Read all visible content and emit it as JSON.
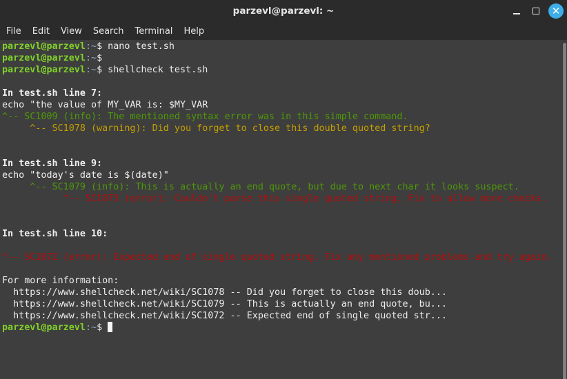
{
  "window": {
    "title": "parzevl@parzevl: ~",
    "controls": {
      "minimize_icon": "minimize-icon",
      "maximize_icon": "maximize-icon",
      "close_icon": "close-icon",
      "close_glyph": "✕"
    },
    "accent_color": "#3daee9"
  },
  "menubar": {
    "items": [
      "File",
      "Edit",
      "View",
      "Search",
      "Terminal",
      "Help"
    ]
  },
  "terminal": {
    "prompt_user": "parzevl@parzevl",
    "prompt_sep": ":",
    "prompt_path": "~",
    "prompt_symbol": "$",
    "colors": {
      "prompt": "#80d12a",
      "info": "#4e9a06",
      "warning": "#c4a000",
      "error": "#b80d0d",
      "text": "#ededed"
    },
    "lines": [
      {
        "type": "prompt",
        "command": " nano test.sh"
      },
      {
        "type": "prompt",
        "command": ""
      },
      {
        "type": "prompt",
        "command": " shellcheck test.sh"
      },
      {
        "type": "blank",
        "text": ""
      },
      {
        "type": "bold",
        "text": "In test.sh line 7:"
      },
      {
        "type": "plain",
        "text": "echo \"the value of MY_VAR is: $MY_VAR"
      },
      {
        "type": "info",
        "text": "^-- SC1009 (info): The mentioned syntax error was in this simple command."
      },
      {
        "type": "warn",
        "text": "     ^-- SC1078 (warning): Did you forget to close this double quoted string?"
      },
      {
        "type": "blank",
        "text": ""
      },
      {
        "type": "blank",
        "text": ""
      },
      {
        "type": "bold",
        "text": "In test.sh line 9:"
      },
      {
        "type": "plain",
        "text": "echo \"today's date is $(date)\""
      },
      {
        "type": "info",
        "text": "     ^-- SC1079 (info): This is actually an end quote, but due to next char it looks suspect."
      },
      {
        "type": "err",
        "text": "           ^-- SC1073 (error): Couldn't parse this single quoted string. Fix to allow more checks."
      },
      {
        "type": "blank",
        "text": ""
      },
      {
        "type": "blank",
        "text": ""
      },
      {
        "type": "bold",
        "text": "In test.sh line 10:"
      },
      {
        "type": "blank",
        "text": ""
      },
      {
        "type": "err",
        "text": "^-- SC1072 (error): Expected end of single quoted string. Fix any mentioned problems and try again."
      },
      {
        "type": "blank",
        "text": ""
      },
      {
        "type": "plain",
        "text": "For more information:"
      },
      {
        "type": "plain",
        "text": "  https://www.shellcheck.net/wiki/SC1078 -- Did you forget to close this doub..."
      },
      {
        "type": "plain",
        "text": "  https://www.shellcheck.net/wiki/SC1079 -- This is actually an end quote, bu..."
      },
      {
        "type": "plain",
        "text": "  https://www.shellcheck.net/wiki/SC1072 -- Expected end of single quoted str..."
      },
      {
        "type": "prompt",
        "command": " "
      }
    ]
  }
}
